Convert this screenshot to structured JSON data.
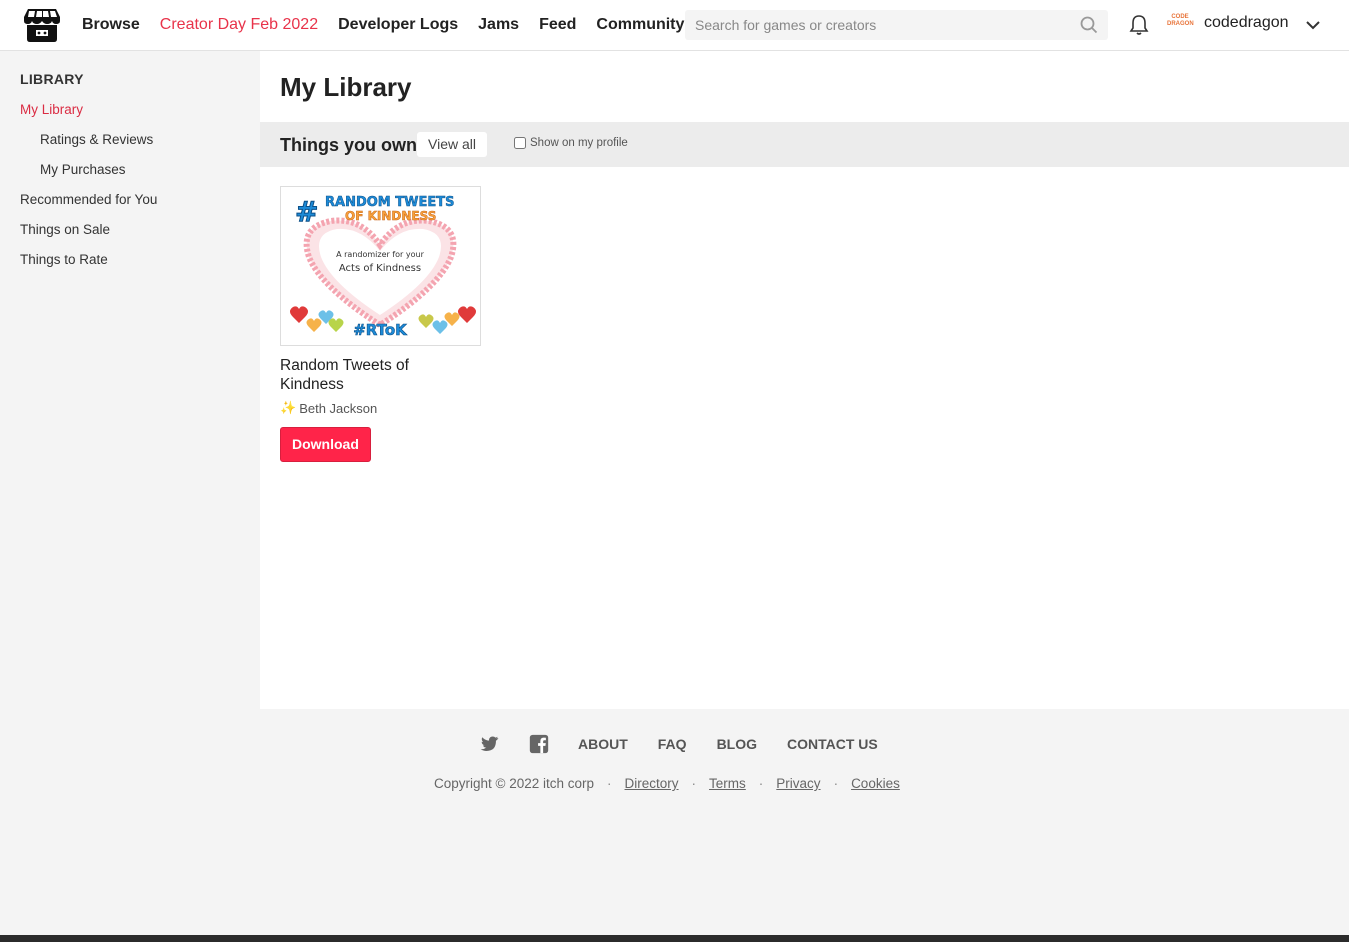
{
  "header": {
    "nav": [
      "Browse",
      "Creator Day Feb 2022",
      "Developer Logs",
      "Jams",
      "Feed",
      "Community"
    ],
    "search_placeholder": "Search for games or creators",
    "avatar_text": "CODE DRAGON",
    "username": "codedragon",
    "accent_color": "#e8334a"
  },
  "sidebar": {
    "heading": "LIBRARY",
    "items": [
      "My Library",
      "Ratings & Reviews",
      "My Purchases",
      "Recommended for You",
      "Things on Sale",
      "Things to Rate"
    ]
  },
  "main": {
    "title": "My Library",
    "section_title": "Things you own",
    "view_all": "View all",
    "show_profile": "Show on my profile",
    "game": {
      "thumb_title_1": "RANDOM TWEETS",
      "thumb_title_2": "OF KINDNESS",
      "thumb_sub_1": "A randomizer for your",
      "thumb_sub_2": "Acts of Kindness",
      "thumb_tag": "#RToK",
      "title": "Random Tweets of Kindness",
      "author": "Beth Jackson",
      "download": "Download",
      "button_color": "#ff2449"
    }
  },
  "footer": {
    "links": [
      "ABOUT",
      "FAQ",
      "BLOG",
      "CONTACT US"
    ],
    "copyright": "Copyright © 2022 itch corp",
    "legal": [
      "Directory",
      "Terms",
      "Privacy",
      "Cookies"
    ]
  }
}
